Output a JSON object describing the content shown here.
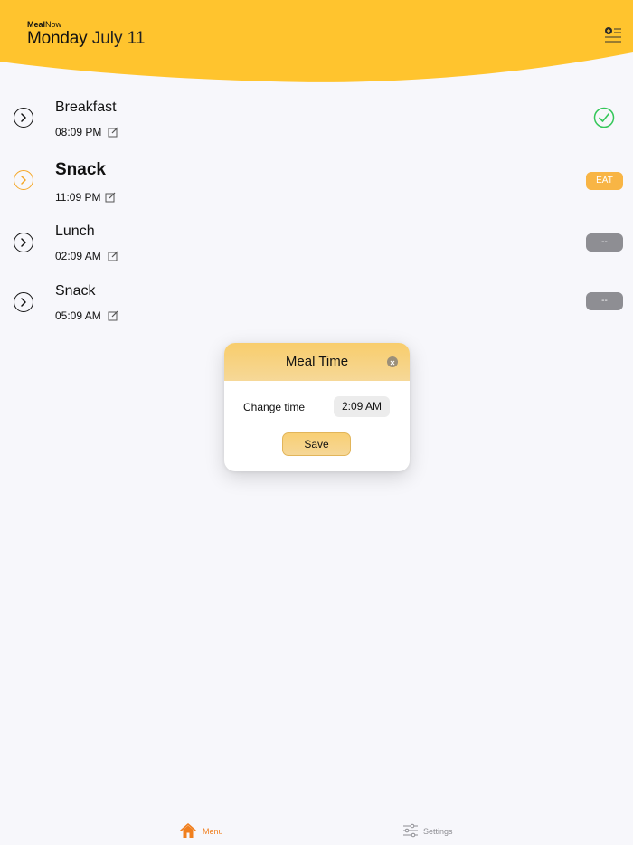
{
  "app": {
    "brand_bold": "Meal",
    "brand_rest": "Now"
  },
  "header": {
    "day": "Monday",
    "month_day": "July 11"
  },
  "meals": [
    {
      "name": "Breakfast",
      "time": "08:09 PM",
      "status": "done"
    },
    {
      "name": "Snack",
      "time": "11:09 PM",
      "status": "eat",
      "status_label": "EAT",
      "active": true
    },
    {
      "name": "Lunch",
      "time": "02:09 AM",
      "status": "pending",
      "status_label": "--"
    },
    {
      "name": "Snack",
      "time": "05:09 AM",
      "status": "pending",
      "status_label": "--"
    }
  ],
  "modal": {
    "title": "Meal Time",
    "change_label": "Change time",
    "time_value": "2:09 AM",
    "save_label": "Save"
  },
  "tabbar": {
    "items": [
      {
        "label": "Menu",
        "icon": "home-icon",
        "active": true
      },
      {
        "label": "Settings",
        "icon": "sliders-icon",
        "active": false
      }
    ]
  },
  "colors": {
    "header_yellow": "#ffc42e",
    "accent_orange": "#f07f1e",
    "eat_pill": "#f8b545",
    "pending_pill": "#8e8e93",
    "check_green": "#34c759",
    "background": "#f7f7fb"
  }
}
